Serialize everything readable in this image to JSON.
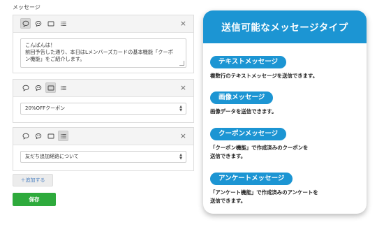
{
  "section_label": "メッセージ",
  "cards": [
    {
      "type": "text",
      "active_tool": 0,
      "text_lines": [
        "こんばんは！",
        "前回予告した通り、本日はLメンバーズカードの基本機能「クーポ",
        "ン機能」をご紹介します。"
      ]
    },
    {
      "type": "image",
      "active_tool": 2,
      "select_value": "20%OFFクーポン"
    },
    {
      "type": "list",
      "active_tool": 3,
      "select_value": "友だち追加経路について"
    }
  ],
  "close_symbol": "×",
  "add_button": "＋追加する",
  "save_button": "保存",
  "icons": [
    "speech-bubble-icon",
    "chat-icon",
    "image-icon",
    "list-icon"
  ],
  "promo": {
    "title": "送信可能なメッセージタイプ",
    "features": [
      {
        "label": "テキストメッセージ",
        "desc": [
          "複数行のテキストメッセージを送信できます。"
        ]
      },
      {
        "label": "画像メッセージ",
        "desc": [
          "画像データを送信できます。"
        ]
      },
      {
        "label": "クーポンメッセージ",
        "desc": [
          "「クーポン機能」で作成済みのクーポンを",
          "送信できます。"
        ]
      },
      {
        "label": "アンケートメッセージ",
        "desc": [
          "「アンケート機能」で作成済みのアンケートを",
          "送信できます。"
        ]
      }
    ]
  },
  "colors": {
    "accent": "#1c95d3",
    "save": "#2eaa3c"
  }
}
